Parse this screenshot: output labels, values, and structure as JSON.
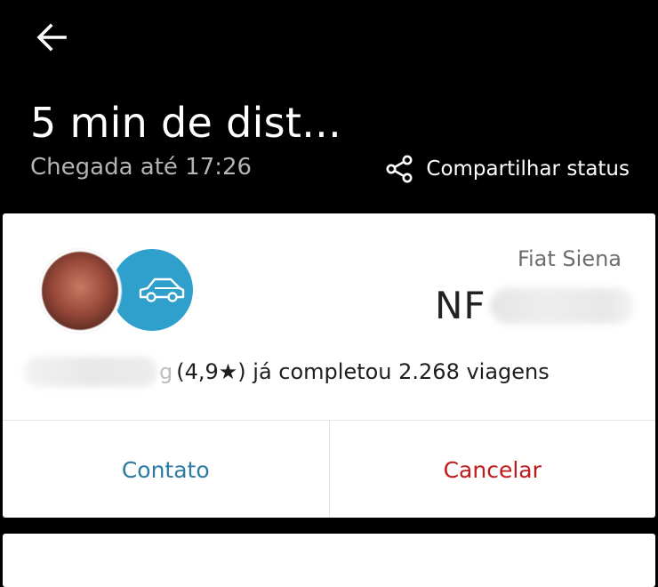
{
  "header": {
    "title": "5 min de dist...",
    "subtitle": "Chegada até 17:26",
    "share_label": "Compartilhar status"
  },
  "trip_card": {
    "car_model": "Fiat Siena",
    "plate_visible": "NF",
    "driver_name_visible_tail": "g",
    "driver_stats": "(4,9★) já completou 2.268 viagens"
  },
  "actions": {
    "contact_label": "Contato",
    "cancel_label": "Cancelar"
  },
  "colors": {
    "header_bg": "#000000",
    "accent_blue": "#2fa0cc",
    "contact_text": "#2d7aa3",
    "cancel_text": "#c21a1a"
  },
  "icons": {
    "back": "arrow-left-icon",
    "share": "share-icon",
    "car": "car-icon"
  }
}
